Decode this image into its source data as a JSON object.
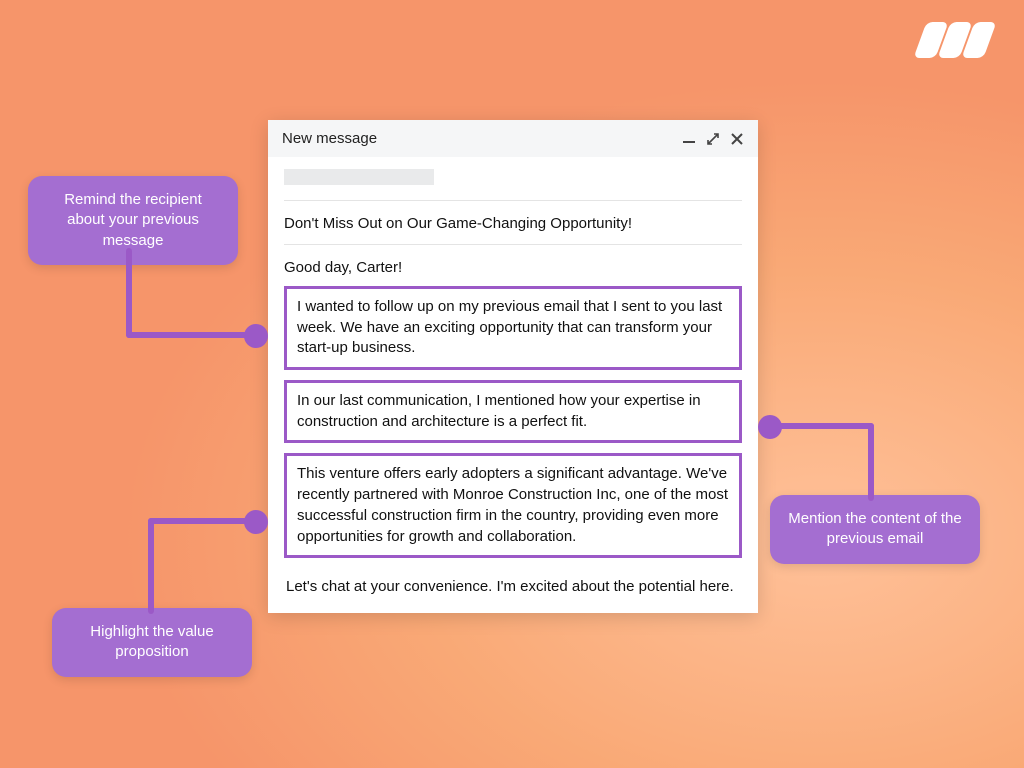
{
  "logo": {
    "name": "brand-logo"
  },
  "compose": {
    "title": "New message",
    "subject": "Don't Miss Out on Our Game-Changing Opportunity!",
    "greeting": "Good day, Carter!",
    "highlight1": "I wanted to follow up on my previous email that I sent to you last week. We have an exciting opportunity that can transform your start-up business.",
    "highlight2": "In our last communication, I mentioned how your expertise in construction and architecture is a perfect fit.",
    "highlight3": "This venture offers early adopters a significant advantage. We've recently partnered with Monroe Construction Inc, one of the most successful construction firm in the country, providing even more opportunities for growth and collaboration.",
    "closing": "Let's chat at your convenience. I'm excited about the potential here."
  },
  "callouts": {
    "c1": "Remind the recipient about your previous message",
    "c2": "Mention the content of the previous email",
    "c3": "Highlight the value proposition"
  },
  "colors": {
    "accent_purple": "#9b59c7",
    "callout_bg": "#a46ed1",
    "bg_peach": "#f9a976"
  }
}
